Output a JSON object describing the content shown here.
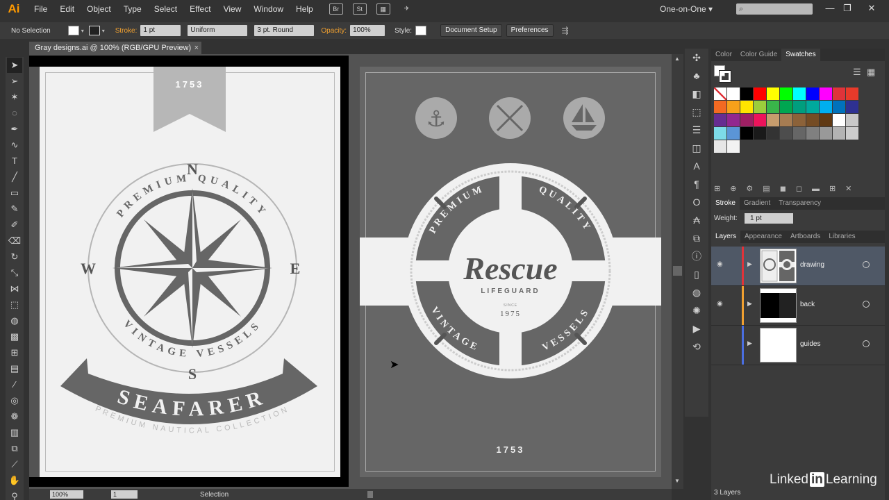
{
  "app": {
    "logo": "Ai"
  },
  "menu": [
    "File",
    "Edit",
    "Object",
    "Type",
    "Select",
    "Effect",
    "View",
    "Window",
    "Help"
  ],
  "menu_icons": [
    "Br",
    "St"
  ],
  "workspace": "One-on-One",
  "control": {
    "selection": "No Selection",
    "stroke_label": "Stroke:",
    "stroke_value": "1 pt",
    "profile": "Uniform",
    "brush": "3 pt. Round",
    "opacity_label": "Opacity:",
    "opacity_value": "100%",
    "style_label": "Style:",
    "doc_setup": "Document Setup",
    "preferences": "Preferences"
  },
  "document": {
    "tab": "Gray designs.ai @ 100% (RGB/GPU Preview)",
    "close": "×"
  },
  "artboard1": {
    "ribbon_year": "1753",
    "n": "N",
    "s": "S",
    "w": "W",
    "e": "E",
    "arc_top": "PREMIUM QUALITY",
    "arc_bottom": "VINTAGE VESSELS",
    "banner": "SEAFARER",
    "tagline": "PREMIUM NAUTICAL COLLECTION"
  },
  "artboard2": {
    "ring_top_left": "PREMIUM",
    "ring_top_right": "QUALITY",
    "ring_bottom_left": "VINTAGE",
    "ring_bottom_right": "VESSELS",
    "title": "Rescue",
    "subtitle": "LIFEGUARD",
    "since": "SINCE",
    "year": "1975",
    "footer_year": "1753"
  },
  "status": {
    "zoom": "100%",
    "page": "1",
    "tool": "Selection"
  },
  "panels": {
    "top_tabs": [
      "Color",
      "Color Guide",
      "Swatches"
    ],
    "stroke_tabs": [
      "Stroke",
      "Gradient",
      "Transparency"
    ],
    "weight_label": "Weight:",
    "weight_value": "1 pt",
    "layer_tabs": [
      "Layers",
      "Appearance",
      "Artboards",
      "Libraries"
    ],
    "layers": [
      {
        "name": "drawing",
        "color": "#e0333a"
      },
      {
        "name": "back",
        "color": "#f0a030"
      },
      {
        "name": "guides",
        "color": "#4a6ee0"
      }
    ],
    "layers_count": "3 Layers"
  },
  "swatches": [
    "#ffffff",
    "#ffffff",
    "#000000",
    "#ff0000",
    "#ffff00",
    "#00ff00",
    "#00ffff",
    "#0000ff",
    "#ff00ff",
    "#e0333a",
    "#e83a2a",
    "#f36a22",
    "#f7a11a",
    "#ffe400",
    "#9bcd3c",
    "#39b54a",
    "#00a651",
    "#009e7e",
    "#00a99d",
    "#00aeef",
    "#0072bc",
    "#2e3192",
    "#662d91",
    "#92278f",
    "#9e1f63",
    "#ed145b",
    "#c69c6d",
    "#a67c52",
    "#8c6239",
    "#754c24",
    "#603913",
    "#ffffff",
    "#c8c8c8",
    "#7ddbe8",
    "#5b95d6",
    "#000000",
    "#1a1a1a",
    "#333333",
    "#4d4d4d",
    "#666666",
    "#808080",
    "#999999",
    "#b3b3b3",
    "#cccccc",
    "#e6e6e6",
    "#f2f2f2"
  ],
  "watermark": {
    "pre": "Linked",
    "in": "in",
    "post": "Learning"
  }
}
